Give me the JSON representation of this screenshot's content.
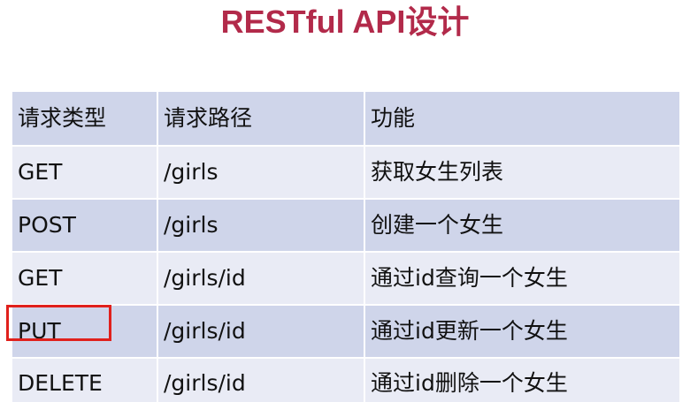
{
  "title": "RESTful API设计",
  "table": {
    "headers": [
      "请求类型",
      "请求路径",
      "功能"
    ],
    "rows": [
      [
        "GET",
        "/girls",
        "获取女生列表"
      ],
      [
        "POST",
        "/girls",
        "创建一个女生"
      ],
      [
        "GET",
        "/girls/id",
        "通过id查询一个女生"
      ],
      [
        "PUT",
        "/girls/id",
        "通过id更新一个女生"
      ],
      [
        "DELETE",
        "/girls/id",
        "通过id删除一个女生"
      ]
    ]
  },
  "highlighted_row": 3,
  "colors": {
    "title": "#b22a4a",
    "row_dark": "#cfd5ea",
    "row_light": "#e9ebf5",
    "highlight_border": "#e0201c"
  }
}
